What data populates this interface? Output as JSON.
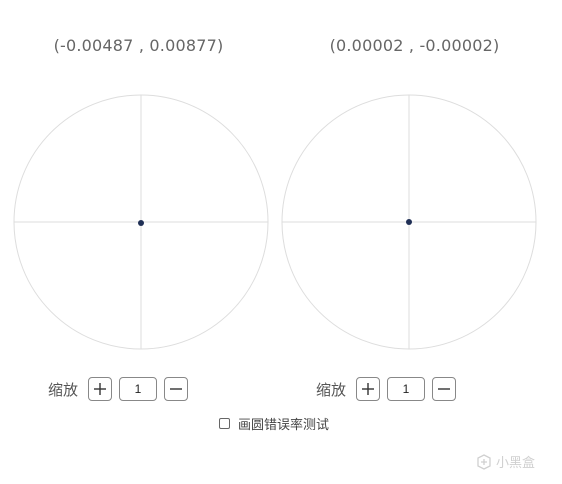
{
  "panels": [
    {
      "coordinate_text": "(-0.00487 , 0.00877)",
      "zoom_label": "缩放",
      "zoom_in_icon": "plus-icon",
      "zoom_value": "1",
      "zoom_out_icon": "minus-icon"
    },
    {
      "coordinate_text": "(0.00002 , -0.00002)",
      "zoom_label": "缩放",
      "zoom_in_icon": "plus-icon",
      "zoom_value": "1",
      "zoom_out_icon": "minus-icon"
    }
  ],
  "error_test": {
    "label": "画圆错误率测试",
    "checked": false
  },
  "watermark": {
    "text": "小黑盒"
  },
  "colors": {
    "circle_stroke": "#dddddd",
    "axis_stroke": "#dddddd",
    "dot_fill": "#1f2f55",
    "text": "#555555"
  }
}
